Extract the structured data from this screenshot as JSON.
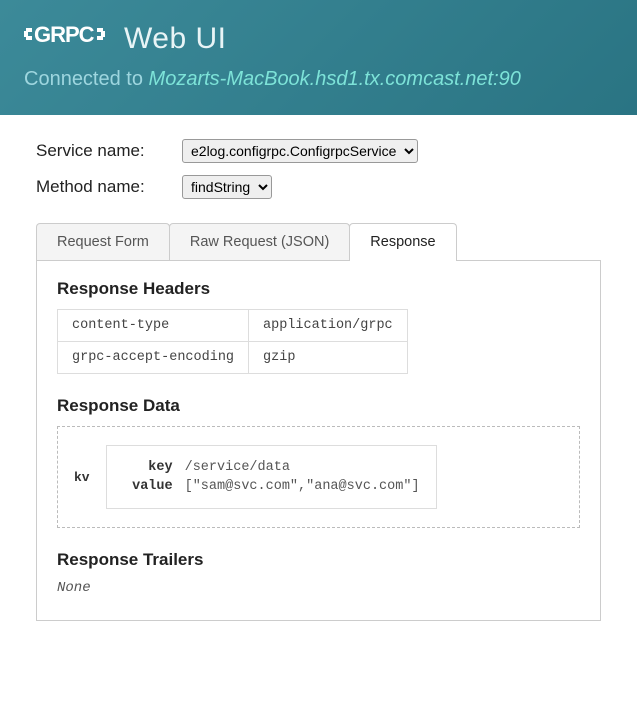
{
  "header": {
    "logo_text": "GRPC",
    "app_title": "Web UI",
    "connected_label": "Connected to ",
    "host": "Mozarts-MacBook.hsd1.tx.comcast.net:90"
  },
  "form": {
    "service_label": "Service name:",
    "service_value": "e2log.configrpc.ConfigrpcService",
    "method_label": "Method name:",
    "method_value": "findString"
  },
  "tabs": {
    "request_form": "Request Form",
    "raw_request": "Raw Request (JSON)",
    "response": "Response"
  },
  "response": {
    "headers_title": "Response Headers",
    "headers": [
      {
        "name": "content-type",
        "value": "application/grpc"
      },
      {
        "name": "grpc-accept-encoding",
        "value": "gzip"
      }
    ],
    "data_title": "Response Data",
    "kv_label": "kv",
    "kv": {
      "key_label": "key",
      "key_value": "/service/data",
      "value_label": "value",
      "value_value": "[\"sam@svc.com\",\"ana@svc.com\"]"
    },
    "trailers_title": "Response Trailers",
    "trailers_value": "None"
  }
}
